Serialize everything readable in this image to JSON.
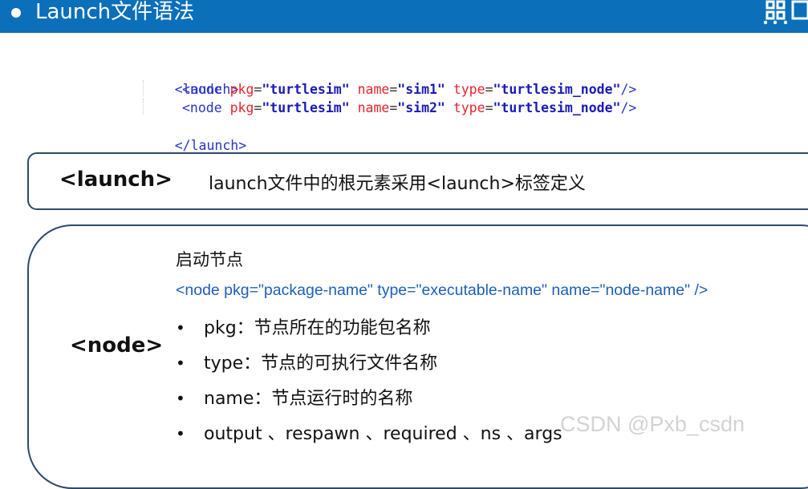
{
  "header": {
    "title": "Launch文件语法",
    "background_color": "#0b6fba",
    "logo_icon": "grid-logo-icon"
  },
  "code": {
    "line1": "<launch>",
    "line2": {
      "open": "<node ",
      "attr1": "pkg",
      "val1": "\"turtlesim\"",
      "attr2": "name",
      "val2": "\"sim1\"",
      "attr3": "type",
      "val3": "\"turtlesim_node\"",
      "close": "/>"
    },
    "line3": {
      "open": "<node ",
      "attr1": "pkg",
      "val1": "\"turtlesim\"",
      "attr2": "name",
      "val2": "\"sim2\"",
      "attr3": "type",
      "val3": "\"turtlesim_node\"",
      "close": "/>"
    },
    "line4": "</launch>",
    "eq": "="
  },
  "launch_section": {
    "tag": "<launch>",
    "description": "launch文件中的根元素采用<launch>标签定义"
  },
  "node_section": {
    "tag": "<node>",
    "heading": "启动节点",
    "syntax": "<node pkg=\"package-name\" type=\"executable-name\" name=\"node-name\" />",
    "bullet_symbol": "•",
    "bullets": [
      "pkg：节点所在的功能包名称",
      "type：节点的可执行文件名称",
      "name：节点运行时的名称",
      "output 、respawn 、required 、ns 、args"
    ]
  },
  "watermark": "CSDN @Pxb_csdn"
}
